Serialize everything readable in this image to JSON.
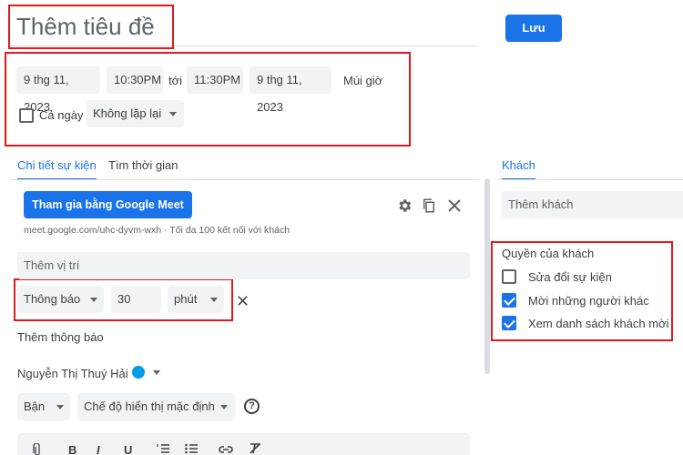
{
  "header": {
    "title_placeholder": "Thêm tiêu đề",
    "save_label": "Lưu"
  },
  "datetime": {
    "start_date": "9 thg 11, 2023",
    "start_time": "10:30PM",
    "to_label": "tới",
    "end_time": "11:30PM",
    "end_date": "9 thg 11, 2023",
    "timezone_label": "Múi giờ",
    "all_day_label": "Cả ngày",
    "all_day_checked": false,
    "repeat_value": "Không lặp lại"
  },
  "tabs": {
    "details": "Chi tiết sự kiện",
    "find_time": "Tìm thời gian",
    "active": "details"
  },
  "meet": {
    "join_label": "Tham gia bằng Google Meet",
    "link_text": "meet.google.com/uhc-dyvm-wxh · Tối đa 100 kết nối với khách"
  },
  "location": {
    "placeholder": "Thêm vị trí"
  },
  "notification": {
    "type": "Thông báo",
    "amount": "30",
    "unit": "phút",
    "add_label": "Thêm thông báo"
  },
  "owner": {
    "name": "Nguyễn Thị Thuý Hải",
    "color": "#039be5"
  },
  "status": {
    "busy": "Bận",
    "visibility": "Chế độ hiển thị mặc định"
  },
  "guests": {
    "tab_label": "Khách",
    "add_placeholder": "Thêm khách",
    "permissions_title": "Quyền của khách",
    "permissions": [
      {
        "label": "Sửa đổi sự kiện",
        "checked": false
      },
      {
        "label": "Mời những người khác",
        "checked": true
      },
      {
        "label": "Xem danh sách khách mời",
        "checked": true
      }
    ]
  },
  "colors": {
    "accent": "#1a73e8",
    "highlight_box": "#e0191e"
  }
}
